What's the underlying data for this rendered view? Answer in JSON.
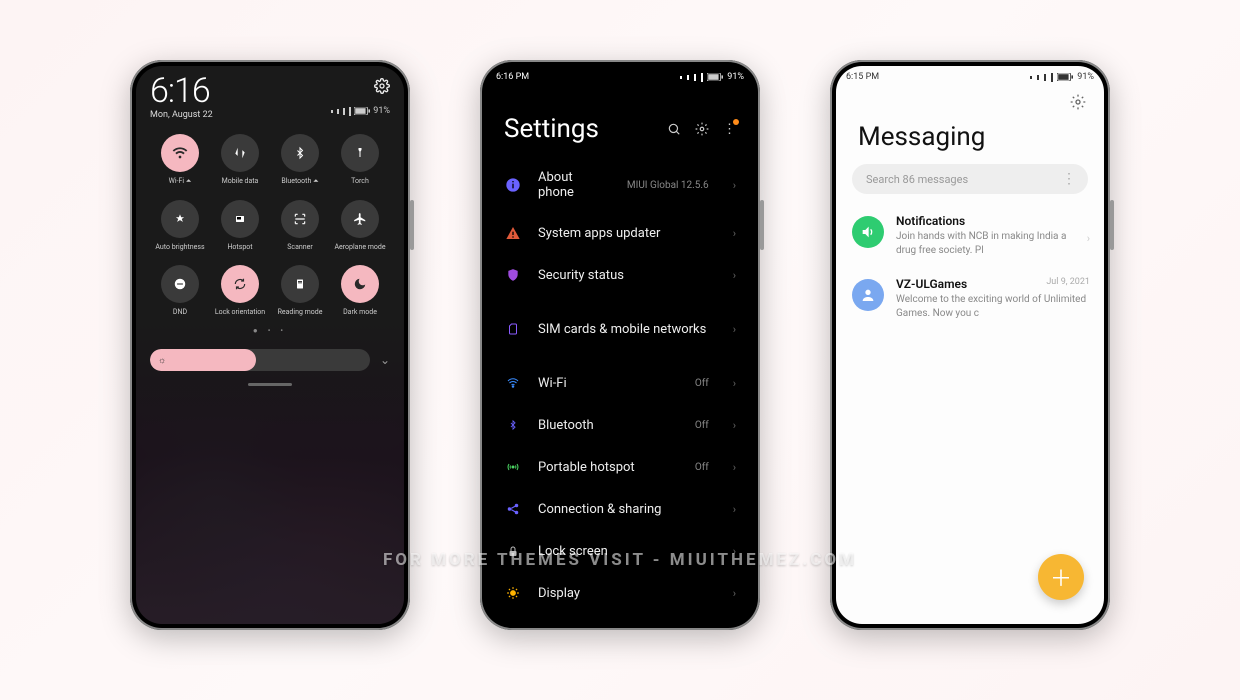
{
  "watermark": "FOR MORE THEMES VISIT - MIUITHEMEZ.COM",
  "phone1": {
    "status_time": "",
    "time": "6:16",
    "date": "Mon, August 22",
    "battery": "91%",
    "tiles": [
      {
        "name": "wifi",
        "label": "Wi-Fi ⏶",
        "active": true
      },
      {
        "name": "mobile-data",
        "label": "Mobile data",
        "active": false
      },
      {
        "name": "bluetooth",
        "label": "Bluetooth ⏶",
        "active": false
      },
      {
        "name": "torch",
        "label": "Torch",
        "active": false
      },
      {
        "name": "auto-bright",
        "label": "Auto brightness",
        "active": false
      },
      {
        "name": "hotspot",
        "label": "Hotspot",
        "active": false
      },
      {
        "name": "scanner",
        "label": "Scanner",
        "active": false
      },
      {
        "name": "airplane",
        "label": "Aeroplane mode",
        "active": false
      },
      {
        "name": "dnd",
        "label": "DND",
        "active": false
      },
      {
        "name": "lock-orient",
        "label": "Lock orientation",
        "active": true
      },
      {
        "name": "read-mode",
        "label": "Reading mode",
        "active": false
      },
      {
        "name": "dark-mode",
        "label": "Dark mode",
        "active": true
      }
    ],
    "brightness_percent": 48
  },
  "phone2": {
    "status_time": "6:16 PM",
    "battery": "91%",
    "title": "Settings",
    "rows": [
      {
        "icon": "info",
        "icon_color": "#6a62ff",
        "label": "About phone",
        "value": "MIUI Global 12.5.6"
      },
      {
        "icon": "warn",
        "icon_color": "#e05a3a",
        "label": "System apps updater",
        "value": ""
      },
      {
        "icon": "shield",
        "icon_color": "#a04ce0",
        "label": "Security status",
        "value": ""
      },
      {
        "icon": "sim",
        "icon_color": "#8a5cff",
        "label": "SIM cards & mobile networks",
        "value": ""
      },
      {
        "icon": "wifi",
        "icon_color": "#3a8cff",
        "label": "Wi-Fi",
        "value": "Off"
      },
      {
        "icon": "bt",
        "icon_color": "#6a62ff",
        "label": "Bluetooth",
        "value": "Off"
      },
      {
        "icon": "hotspot",
        "icon_color": "#4cd964",
        "label": "Portable hotspot",
        "value": "Off"
      },
      {
        "icon": "share",
        "icon_color": "#6a62ff",
        "label": "Connection & sharing",
        "value": ""
      },
      {
        "icon": "lock",
        "icon_color": "#bdbdbd",
        "label": "Lock screen",
        "value": ""
      },
      {
        "icon": "display",
        "icon_color": "#ffb300",
        "label": "Display",
        "value": ""
      }
    ]
  },
  "phone3": {
    "status_time": "6:15 PM",
    "battery": "91%",
    "title": "Messaging",
    "search_placeholder": "Search 86 messages",
    "items": [
      {
        "avatar": "speaker",
        "avatar_bg": "green",
        "name": "Notifications",
        "text": "Join hands with NCB in making India a drug free society. Pl",
        "date": ""
      },
      {
        "avatar": "person",
        "avatar_bg": "blue",
        "name": "VZ-ULGames",
        "text": "Welcome to the exciting world of Unlimited Games. Now you c",
        "date": "Jul 9, 2021"
      }
    ]
  }
}
